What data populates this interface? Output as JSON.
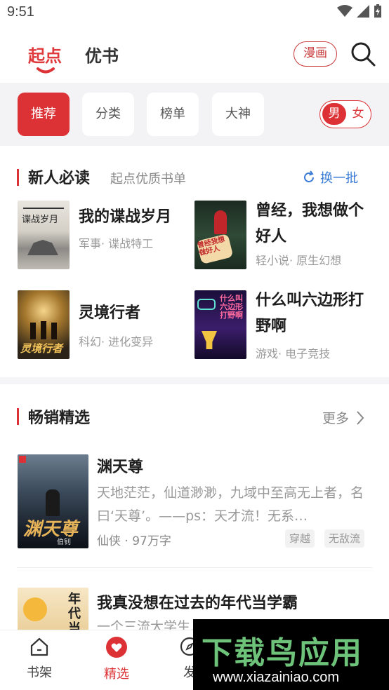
{
  "status_bar": {
    "time": "9:51"
  },
  "top_nav": {
    "tabs": [
      {
        "label": "起点"
      },
      {
        "label": "优书"
      }
    ],
    "manhua_label": "漫画"
  },
  "filters": {
    "chips": [
      {
        "label": "推荐"
      },
      {
        "label": "分类"
      },
      {
        "label": "榜单"
      },
      {
        "label": "大神"
      }
    ],
    "gender": {
      "male": "男",
      "female": "女"
    }
  },
  "new_reads": {
    "title": "新人必读",
    "subtitle": "起点优质书单",
    "refresh_label": "换一批",
    "books": [
      {
        "title": "我的谍战岁月",
        "meta": "军事· 谍战特工",
        "cover_text": "谍战岁月"
      },
      {
        "title": "曾经，我想做个好人",
        "meta": "轻小说· 原生幻想",
        "cover_text": "曾经我想做好人"
      },
      {
        "title": "灵境行者",
        "meta": "科幻· 进化变异",
        "cover_text": "灵境行者"
      },
      {
        "title": "什么叫六边形打野啊",
        "meta": "游戏· 电子竞技",
        "cover_text": "什么叫六边形打野啊"
      }
    ]
  },
  "bestsellers": {
    "title": "畅销精选",
    "more_label": "更多",
    "items": [
      {
        "title": "渊天尊",
        "description": "天地茫茫，仙道渺渺，九域中至高无上者，名曰‘天尊’。——ps：天才流！无系…",
        "meta": "仙侠 · 97万字",
        "tags": [
          "穿越",
          "无敌流"
        ],
        "cover_text": "渊天尊",
        "cover_author": "伯钊"
      },
      {
        "title": "我真没想在过去的年代当学霸",
        "description": "一个三流大学生…",
        "cover_text": "年代当"
      }
    ]
  },
  "bottom_nav": {
    "items": [
      {
        "label": "书架"
      },
      {
        "label": "精选"
      },
      {
        "label": "发"
      }
    ]
  },
  "watermark": {
    "title": "下载鸟应用",
    "url": "www.xiazainiao.com"
  },
  "colors": {
    "brand_red": "#dd3235",
    "link_blue": "#3a7bd5",
    "watermark_green": "#6ec37a"
  }
}
